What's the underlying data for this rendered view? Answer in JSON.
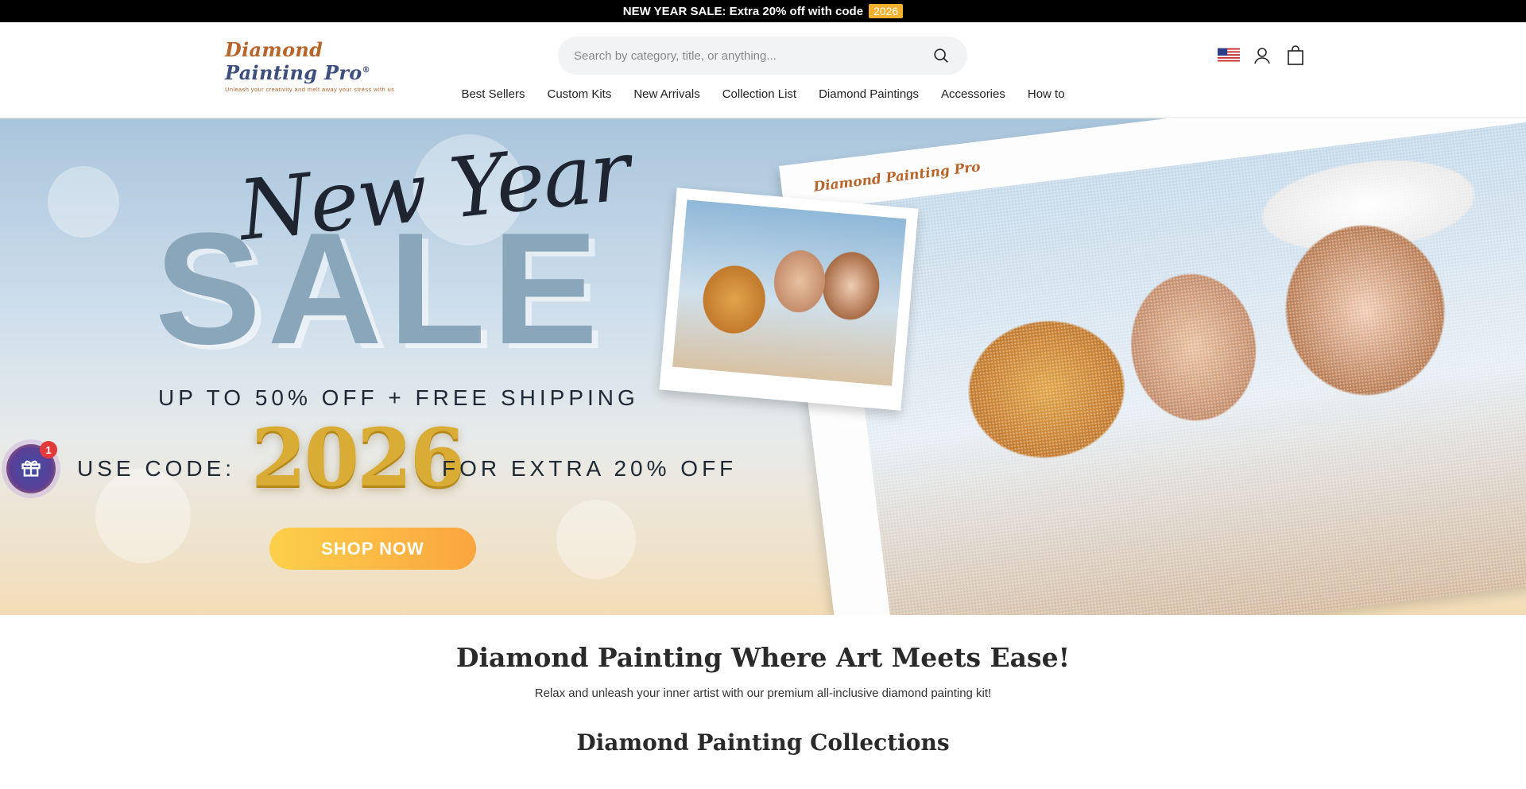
{
  "announcement": {
    "text": "NEW YEAR SALE: Extra 20% off with code",
    "code": "2026"
  },
  "header": {
    "logo": {
      "word1": "Diamond",
      "word2": "Painting Pro",
      "mark": "®",
      "tagline": "Unleash your creativity and melt away your stress with us"
    },
    "search": {
      "placeholder": "Search by category, title, or anything..."
    },
    "utility_icons": [
      "us-flag-icon",
      "user-icon",
      "bag-icon"
    ]
  },
  "nav": {
    "items": [
      {
        "label": "Best Sellers"
      },
      {
        "label": "Custom Kits"
      },
      {
        "label": "New Arrivals"
      },
      {
        "label": "Collection List"
      },
      {
        "label": "Diamond Paintings"
      },
      {
        "label": "Accessories"
      },
      {
        "label": "How to"
      }
    ]
  },
  "hero": {
    "script": "New Year",
    "headline": "SALE",
    "offer": "UP TO 50% OFF + FREE SHIPPING",
    "use_code": "USE CODE:",
    "code": "2026",
    "extra": "FOR EXTRA 20% OFF",
    "cta": "SHOP NOW",
    "canvas_brand": "Diamond Painting Pro"
  },
  "gift_widget": {
    "badge": "1"
  },
  "intro": {
    "title": "Diamond Painting Where Art Meets Ease!",
    "subtitle": "Relax and unleash your inner artist with our premium all-inclusive diamond painting kit!"
  },
  "collections": {
    "title": "Diamond Painting Collections"
  },
  "colors": {
    "announcement_bg": "#000000",
    "code_badge": "#f5b12e",
    "cta_start": "#fcd04a",
    "cta_end": "#fba53f",
    "sale_text": "#8aa6bb"
  }
}
